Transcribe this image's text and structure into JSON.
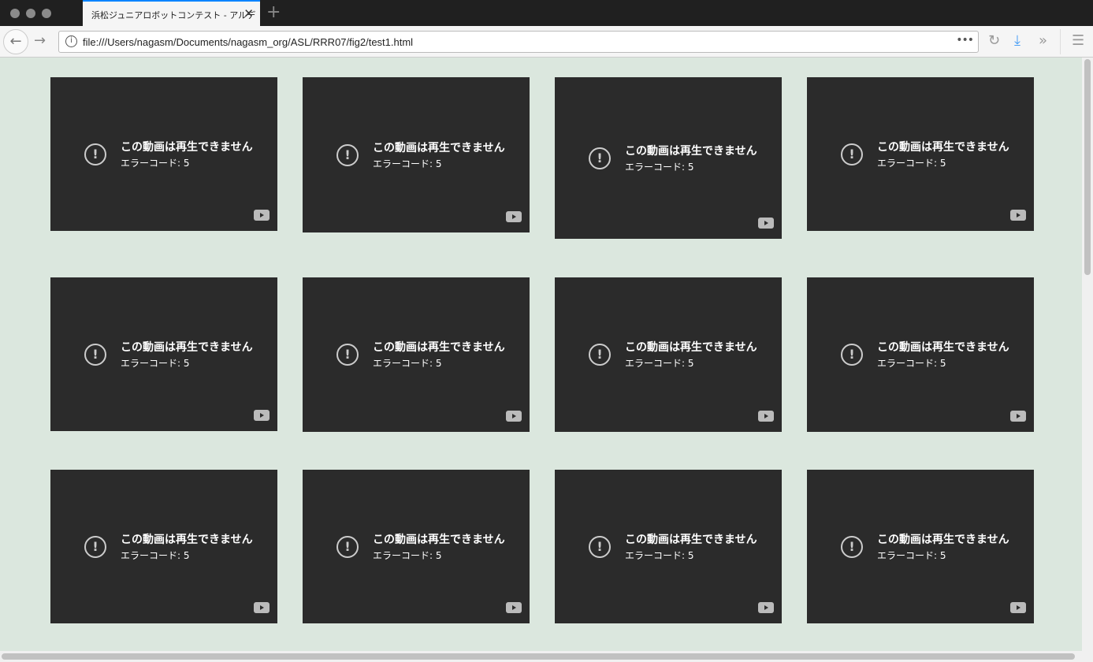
{
  "browser": {
    "tab_title": "浜松ジュニアロボットコンテスト - アルデ",
    "url": "file:///Users/nagasm/Documents/nagasm_org/ASL/RRR07/fig2/test1.html",
    "accent": "#0a84ff"
  },
  "videos": [
    {
      "message": "この動画は再生できません",
      "error": "エラーコード: 5"
    },
    {
      "message": "この動画は再生できません",
      "error": "エラーコード: 5"
    },
    {
      "message": "この動画は再生できません",
      "error": "エラーコード: 5"
    },
    {
      "message": "この動画は再生できません",
      "error": "エラーコード: 5"
    },
    {
      "message": "この動画は再生できません",
      "error": "エラーコード: 5"
    },
    {
      "message": "この動画は再生できません",
      "error": "エラーコード: 5"
    },
    {
      "message": "この動画は再生できません",
      "error": "エラーコード: 5"
    },
    {
      "message": "この動画は再生できません",
      "error": "エラーコード: 5"
    },
    {
      "message": "この動画は再生できません",
      "error": "エラーコード: 5"
    },
    {
      "message": "この動画は再生できません",
      "error": "エラーコード: 5"
    },
    {
      "message": "この動画は再生できません",
      "error": "エラーコード: 5"
    },
    {
      "message": "この動画は再生できません",
      "error": "エラーコード: 5"
    }
  ]
}
